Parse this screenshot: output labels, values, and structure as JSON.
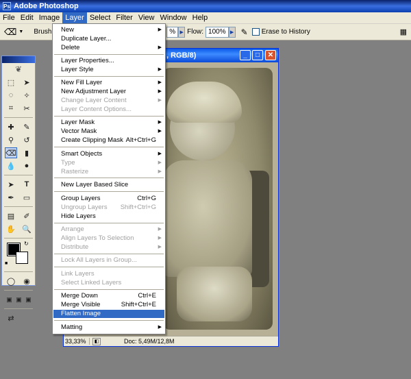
{
  "app": {
    "title": "Adobe Photoshop"
  },
  "menubar": [
    "File",
    "Edit",
    "Image",
    "Layer",
    "Select",
    "Filter",
    "View",
    "Window",
    "Help"
  ],
  "optionsbar": {
    "brush_label": "Brush:",
    "opacity_value": "%",
    "flow_label": "Flow:",
    "flow_value": "100%",
    "erase_to_history_label": "Erase to History"
  },
  "document": {
    "title": ", RGB/8)",
    "zoom": "33,33%",
    "doc_info": "Doc: 5,49M/12,8M"
  },
  "layer_menu": {
    "items": [
      {
        "label": "New",
        "arrow": true
      },
      {
        "label": "Duplicate Layer..."
      },
      {
        "label": "Delete",
        "arrow": true
      },
      {
        "label": "Layer Properties..."
      },
      {
        "label": "Layer Style",
        "arrow": true
      },
      {
        "label": "New Fill Layer",
        "arrow": true
      },
      {
        "label": "New Adjustment Layer",
        "arrow": true
      },
      {
        "label": "Change Layer Content",
        "arrow": true,
        "disabled": true
      },
      {
        "label": "Layer Content Options...",
        "disabled": true
      },
      {
        "label": "Layer Mask",
        "arrow": true
      },
      {
        "label": "Vector Mask",
        "arrow": true
      },
      {
        "label": "Create Clipping Mask",
        "shortcut": "Alt+Ctrl+G"
      },
      {
        "label": "Smart Objects",
        "arrow": true
      },
      {
        "label": "Type",
        "arrow": true,
        "disabled": true
      },
      {
        "label": "Rasterize",
        "arrow": true,
        "disabled": true
      },
      {
        "label": "New Layer Based Slice"
      },
      {
        "label": "Group Layers",
        "shortcut": "Ctrl+G"
      },
      {
        "label": "Ungroup Layers",
        "shortcut": "Shift+Ctrl+G",
        "disabled": true
      },
      {
        "label": "Hide Layers"
      },
      {
        "label": "Arrange",
        "arrow": true,
        "disabled": true
      },
      {
        "label": "Align Layers To Selection",
        "arrow": true,
        "disabled": true
      },
      {
        "label": "Distribute",
        "arrow": true,
        "disabled": true
      },
      {
        "label": "Lock All Layers in Group...",
        "disabled": true
      },
      {
        "label": "Link Layers",
        "disabled": true
      },
      {
        "label": "Select Linked Layers",
        "disabled": true
      },
      {
        "label": "Merge Down",
        "shortcut": "Ctrl+E"
      },
      {
        "label": "Merge Visible",
        "shortcut": "Shift+Ctrl+E"
      },
      {
        "label": "Flatten Image",
        "highlighted": true
      },
      {
        "label": "Matting",
        "arrow": true
      }
    ]
  }
}
